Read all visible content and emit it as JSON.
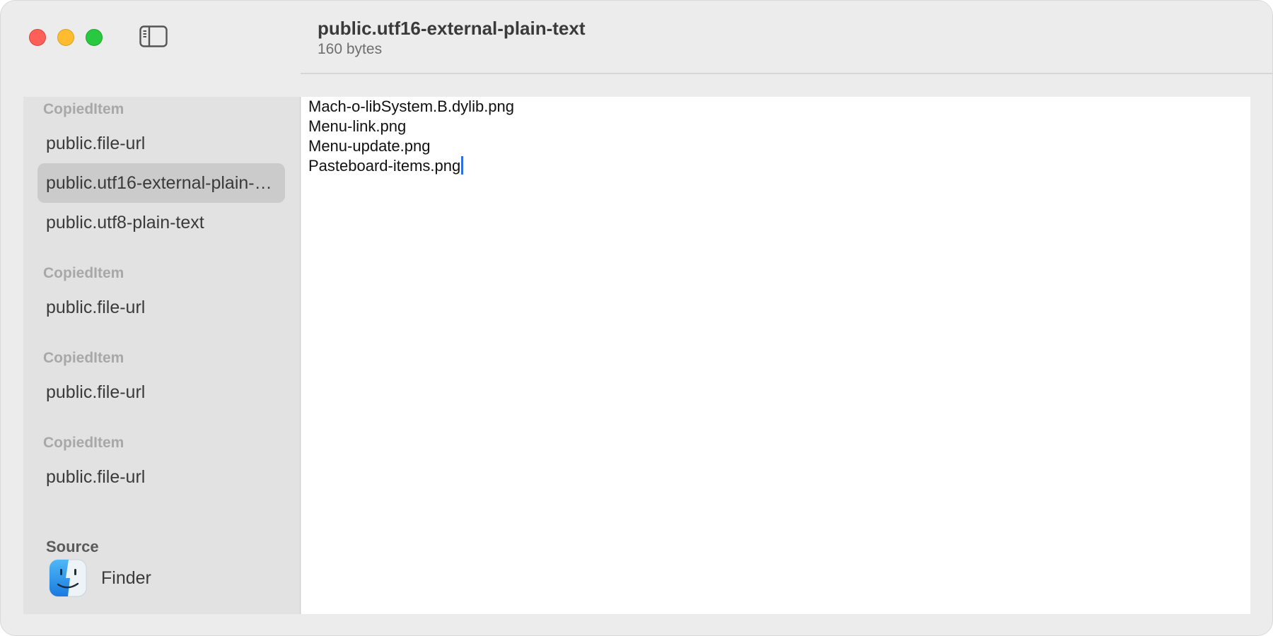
{
  "header": {
    "title": "public.utf16-external-plain-text",
    "subtitle": "160 bytes"
  },
  "sidebar": {
    "groups": [
      {
        "title": "CopiedItem",
        "items": [
          "public.file-url",
          "public.utf16-external-plain-text",
          "public.utf8-plain-text"
        ],
        "selected_index": 1
      },
      {
        "title": "CopiedItem",
        "items": [
          "public.file-url"
        ]
      },
      {
        "title": "CopiedItem",
        "items": [
          "public.file-url"
        ]
      },
      {
        "title": "CopiedItem",
        "items": [
          "public.file-url"
        ]
      }
    ],
    "source": {
      "label": "Source",
      "app_name": "Finder",
      "app_icon": "finder-icon"
    }
  },
  "content": {
    "lines": [
      "Mach-o-libSystem.B.dylib.png",
      "Menu-link.png",
      "Menu-update.png",
      "Pasteboard-items.png"
    ]
  },
  "colors": {
    "close": "#fe5f57",
    "minimize": "#febc2e",
    "zoom": "#28c840",
    "caret": "#2f6fe4",
    "selection": "#cbcbcb"
  }
}
